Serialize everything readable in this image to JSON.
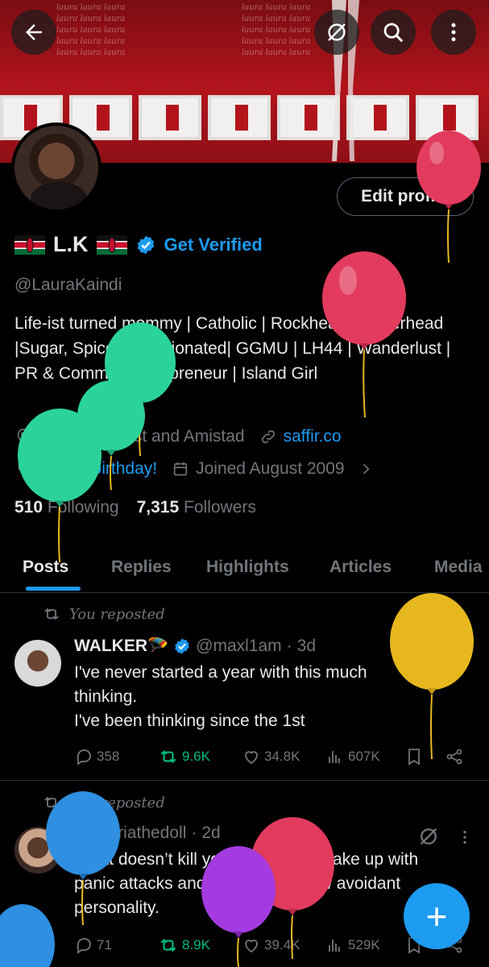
{
  "header": {
    "banner_text": "laura laura laura",
    "back_icon": "arrow-left-icon",
    "actions": [
      "grok-icon",
      "search-icon",
      "more-vertical-icon"
    ]
  },
  "profile": {
    "edit_button": "Edit profile",
    "name": "L.K",
    "get_verified": "Get Verified",
    "handle": "@LauraKaindi",
    "bio": "Life-ist turned mommy | Catholic | Rockhead | Potterhead |Sugar, Spice & Opinionated| GGMU | LH44 | Wanderlust | PR & Comms | Kukupreneur | Island Girl",
    "location": "Corner of First and Amistad",
    "website": "saffir.co",
    "birthday": "Happy birthday!",
    "joined": "Joined August 2009",
    "following_count": "510",
    "following_label": "Following",
    "followers_count": "7,315",
    "followers_label": "Followers"
  },
  "tabs": [
    "Posts",
    "Replies",
    "Highlights",
    "Articles",
    "Media"
  ],
  "posts": [
    {
      "repost_label": "You reposted",
      "name": "WALKER🪂",
      "handle": "@maxl1am",
      "time": "3d",
      "text": [
        "I've never started a year with this much",
        "thinking.",
        "I've been thinking since the 1st"
      ],
      "replies": "358",
      "reposts": "9.6K",
      "likes": "34.8K",
      "views": "607K"
    },
    {
      "repost_label": "You reposted",
      "name": "T",
      "handle": "@Ariathedoll",
      "time": "2d",
      "text": [
        "What doesn’t kill you makes you wake up with",
        "panic attacks and gives you a new avoidant",
        "personality."
      ],
      "replies": "71",
      "reposts": "8.9K",
      "likes": "39.4K",
      "views": "529K"
    }
  ],
  "fab_label": "+",
  "colors": {
    "accent": "#1d9bf0",
    "repost_green": "#00ba7c",
    "muted": "#71767b",
    "balloon_red": "#e23b5e",
    "balloon_green": "#2bd39a",
    "balloon_yellow": "#e6b81e",
    "balloon_blue": "#2f8fe0",
    "balloon_purple": "#a43be0"
  }
}
